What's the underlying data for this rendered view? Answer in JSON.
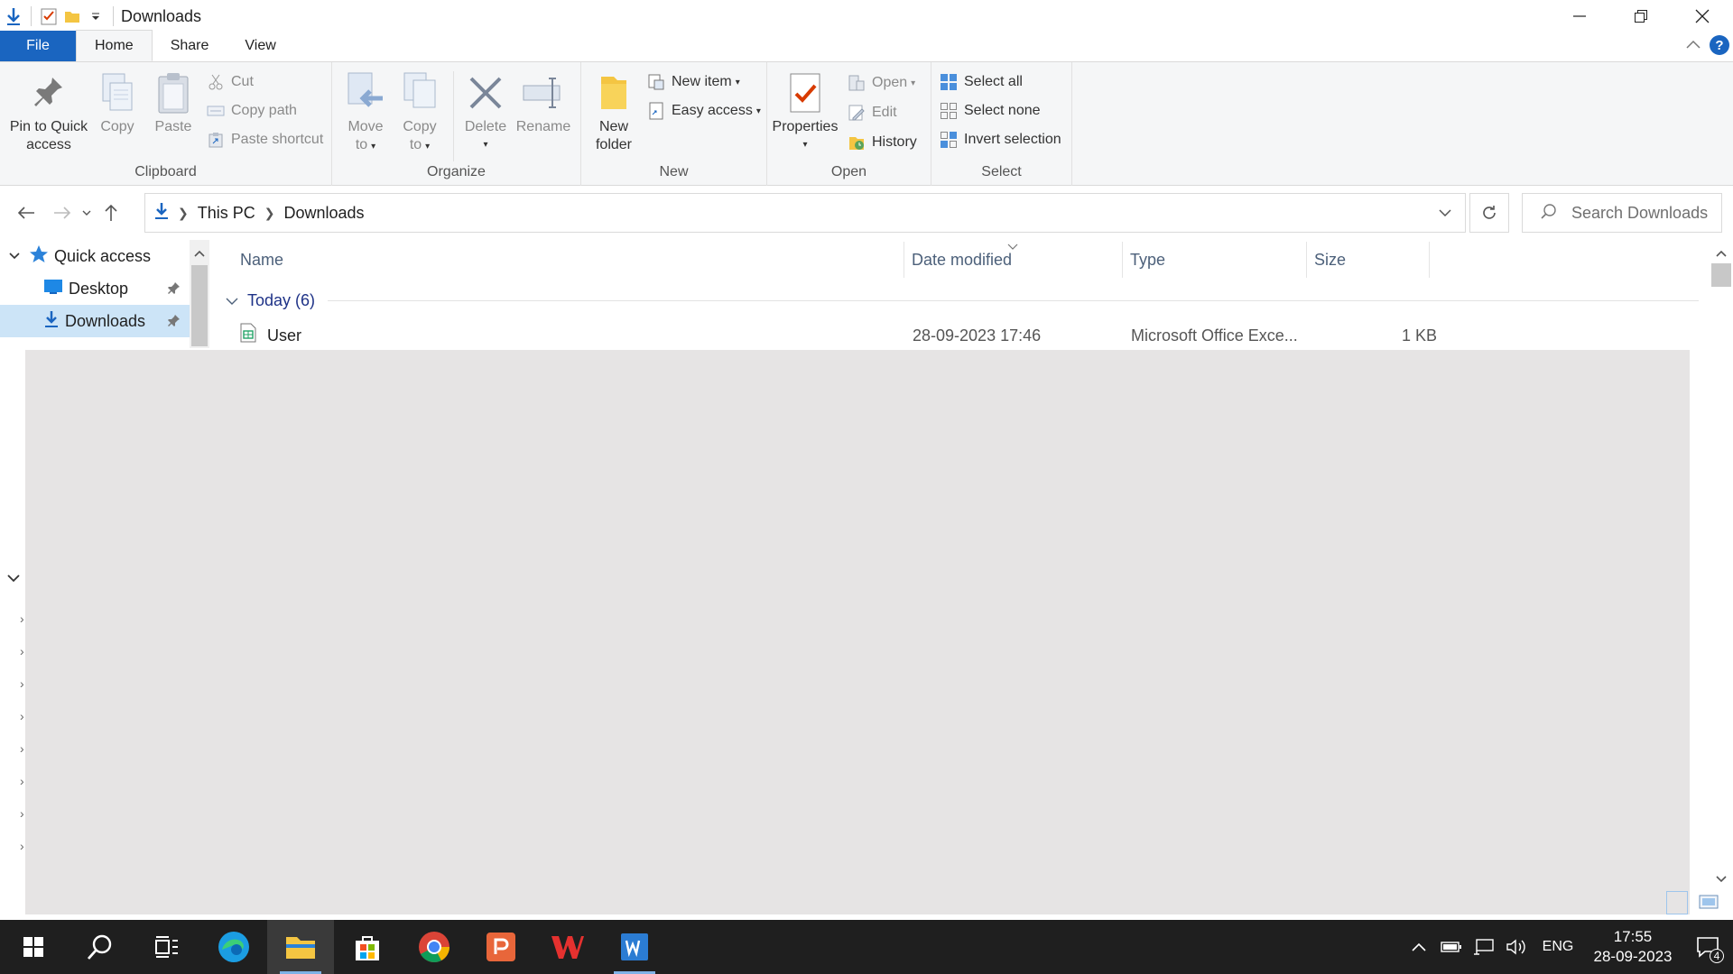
{
  "window": {
    "title": "Downloads"
  },
  "ribbon_tabs": [
    {
      "label": "File"
    },
    {
      "label": "Home"
    },
    {
      "label": "Share"
    },
    {
      "label": "View"
    }
  ],
  "ribbon": {
    "clipboard": {
      "label": "Clipboard",
      "pin_line1": "Pin to Quick",
      "pin_line2": "access",
      "copy": "Copy",
      "paste": "Paste",
      "cut": "Cut",
      "copy_path": "Copy path",
      "paste_shortcut": "Paste shortcut"
    },
    "organize": {
      "label": "Organize",
      "move_line1": "Move",
      "move_line2": "to",
      "copy_line1": "Copy",
      "copy_line2": "to",
      "delete": "Delete",
      "rename": "Rename"
    },
    "new": {
      "label": "New",
      "folder_line1": "New",
      "folder_line2": "folder",
      "new_item": "New item",
      "easy_access": "Easy access"
    },
    "open": {
      "label": "Open",
      "properties": "Properties",
      "open": "Open",
      "edit": "Edit",
      "history": "History"
    },
    "select": {
      "label": "Select",
      "select_all": "Select all",
      "select_none": "Select none",
      "invert_selection": "Invert selection"
    }
  },
  "address": {
    "crumbs": [
      "This PC",
      "Downloads"
    ],
    "search_placeholder": "Search Downloads"
  },
  "nav_pane": {
    "items": [
      {
        "label": "Quick access"
      },
      {
        "label": "Desktop"
      },
      {
        "label": "Downloads"
      }
    ]
  },
  "file_list": {
    "columns": [
      "Name",
      "Date modified",
      "Type",
      "Size"
    ],
    "group": "Today (6)",
    "rows": [
      {
        "name": "User",
        "date": "28-09-2023 17:46",
        "type": "Microsoft Office Exce...",
        "size": "1 KB"
      }
    ]
  },
  "taskbar": {
    "language": "ENG",
    "time": "17:55",
    "date": "28-09-2023",
    "notification_count": "4"
  },
  "colors": {
    "accent": "#1a65c0",
    "selection": "#cce4f7",
    "taskbar": "#1f1f1f",
    "overlay": "#e6e4e4"
  }
}
